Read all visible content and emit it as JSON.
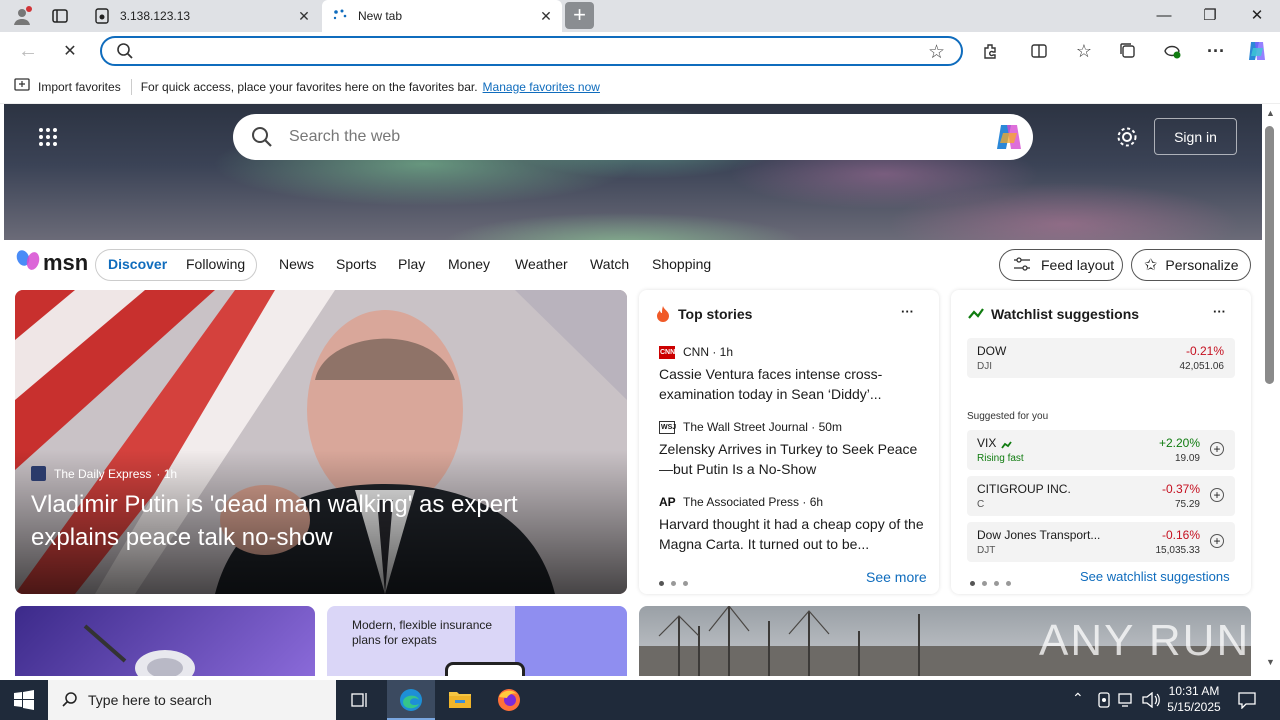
{
  "browser": {
    "tabs": [
      {
        "title": "3.138.123.13",
        "active": false
      },
      {
        "title": "New tab",
        "active": true
      }
    ],
    "address_value": "",
    "favorites_bar": {
      "import_label": "Import favorites",
      "message": "For quick access, place your favorites here on the favorites bar.",
      "manage_link": "Manage favorites now"
    }
  },
  "newtab": {
    "search_placeholder": "Search the web",
    "sign_in": "Sign in",
    "msn_logo": "msn",
    "feed_tabs": [
      "Discover",
      "Following"
    ],
    "nav_links": [
      "News",
      "Sports",
      "Play",
      "Money",
      "Weather",
      "Watch",
      "Shopping"
    ],
    "feed_layout": "Feed layout",
    "personalize": "Personalize",
    "hero": {
      "source": "The Daily Express",
      "age": "· 1h",
      "headline": "Vladimir Putin is 'dead man walking' as expert explains peace talk no-show"
    },
    "top_stories": {
      "title": "Top stories",
      "items": [
        {
          "badge": "CNN",
          "source": "CNN · 1h",
          "headline": "Cassie Ventura faces intense cross-examination today in Sean ‘Diddy’..."
        },
        {
          "badge": "WSJ",
          "source": "The Wall Street Journal · 50m",
          "headline": "Zelensky Arrives in Turkey to Seek Peace—but Putin Is a No-Show"
        },
        {
          "badge": "AP",
          "source": "The Associated Press · 6h",
          "headline": "Harvard thought it had a cheap copy of the Magna Carta. It turned out to be..."
        }
      ],
      "see_more": "See more"
    },
    "watchlist": {
      "title": "Watchlist suggestions",
      "pinned": {
        "name": "DOW",
        "symbol": "DJI",
        "change": "-0.21%",
        "price": "42,051.06"
      },
      "suggested_label": "Suggested for you",
      "suggestions": [
        {
          "name": "VIX",
          "symbol": "Rising fast",
          "change": "+2.20%",
          "price": "19.09",
          "positive": true
        },
        {
          "name": "CITIGROUP INC.",
          "symbol": "C",
          "change": "-0.37%",
          "price": "75.29",
          "positive": false
        },
        {
          "name": "Dow Jones Transport...",
          "symbol": "DJT",
          "change": "-0.16%",
          "price": "15,035.33",
          "positive": false
        }
      ],
      "see_link": "See watchlist suggestions"
    },
    "promo": "Modern, flexible insurance plans for expats",
    "watermark": "ANY RUN"
  },
  "taskbar": {
    "search_placeholder": "Type here to search",
    "time": "10:31 AM",
    "date": "5/15/2025"
  },
  "colors": {
    "accent": "#0f6cbd",
    "negative": "#c50f1f",
    "positive": "#107c10",
    "taskbar": "#1f2a3a"
  }
}
